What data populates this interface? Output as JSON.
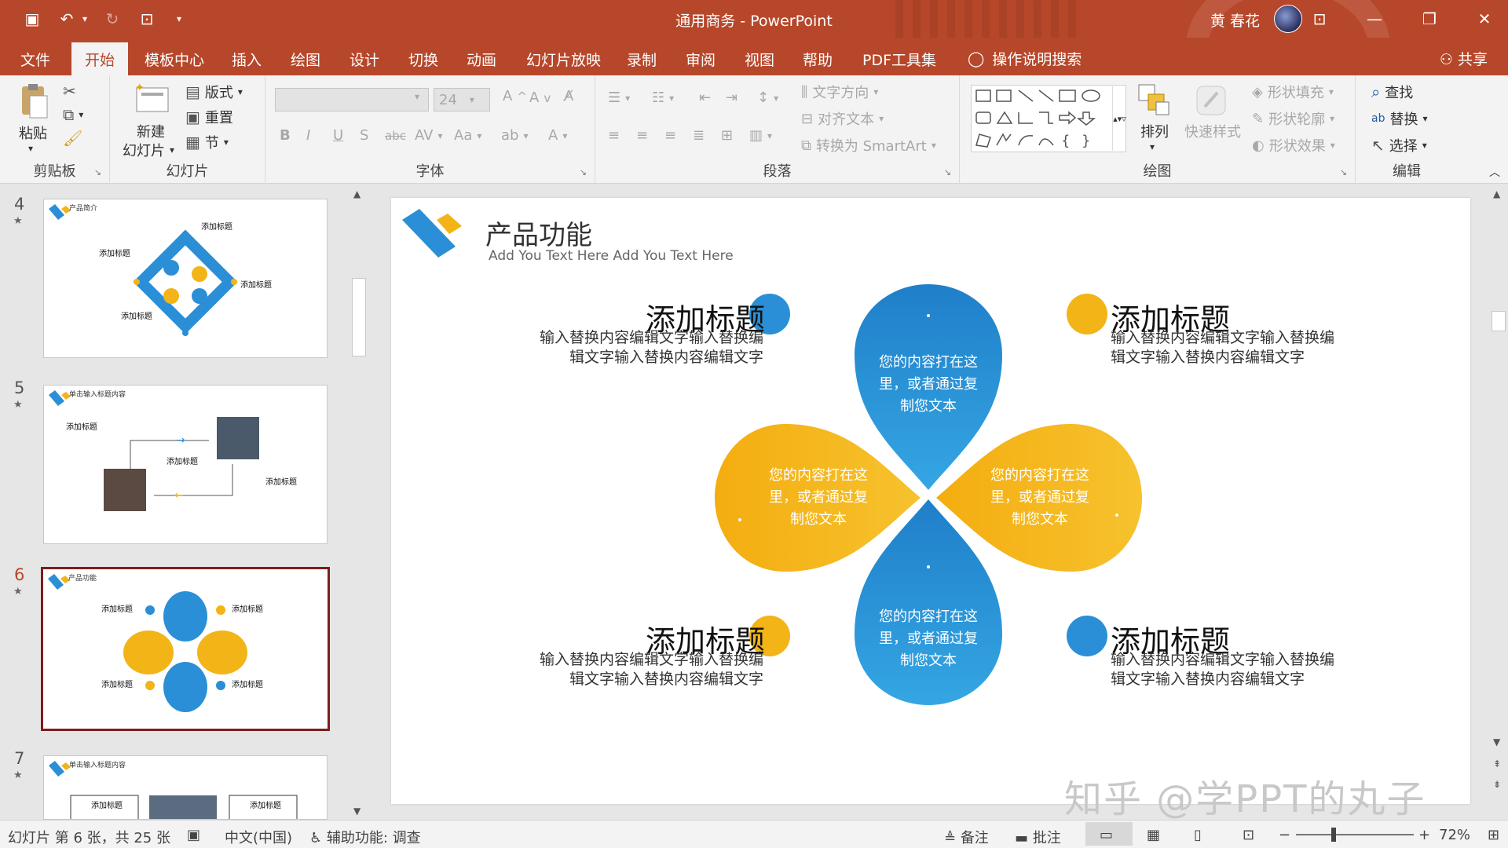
{
  "titlebar": {
    "document_title": "通用商务  -  PowerPoint",
    "user_name": "黄 春花",
    "window_buttons": [
      "ribbon-display-icon",
      "minimize-icon",
      "restore-icon",
      "close-icon"
    ]
  },
  "tabs": [
    {
      "label": "文件",
      "active": false
    },
    {
      "label": "开始",
      "active": true
    },
    {
      "label": "模板中心",
      "active": false
    },
    {
      "label": "插入",
      "active": false
    },
    {
      "label": "绘图",
      "active": false
    },
    {
      "label": "设计",
      "active": false
    },
    {
      "label": "切换",
      "active": false
    },
    {
      "label": "动画",
      "active": false
    },
    {
      "label": "幻灯片放映",
      "active": false
    },
    {
      "label": "录制",
      "active": false
    },
    {
      "label": "审阅",
      "active": false
    },
    {
      "label": "视图",
      "active": false
    },
    {
      "label": "帮助",
      "active": false
    },
    {
      "label": "PDF工具集",
      "active": false
    }
  ],
  "tell_me": "操作说明搜索",
  "share": "共享",
  "ribbon": {
    "clipboard": {
      "label": "剪贴板",
      "paste": "粘贴"
    },
    "slides": {
      "label": "幻灯片",
      "new_slide_1": "新建",
      "new_slide_2": "幻灯片",
      "layout": "版式",
      "reset": "重置",
      "section": "节"
    },
    "font": {
      "label": "字体",
      "font_name": "",
      "font_size": "24"
    },
    "paragraph": {
      "label": "段落",
      "text_direction": "文字方向",
      "align_text": "对齐文本",
      "smartart": "转换为 SmartArt"
    },
    "drawing": {
      "label": "绘图",
      "arrange": "排列",
      "quick_styles": "快速样式",
      "shape_fill": "形状填充",
      "shape_outline": "形状轮廓",
      "shape_effects": "形状效果"
    },
    "editing": {
      "label": "编辑",
      "find": "查找",
      "replace": "替换",
      "select": "选择"
    }
  },
  "thumbnails": [
    {
      "number": "4",
      "title": "产品简介",
      "heading": "添加标题"
    },
    {
      "number": "5",
      "title": "单击输入标题内容",
      "heading": "添加标题"
    },
    {
      "number": "6",
      "title": "产品功能",
      "heading": "添加标题",
      "selected": true
    },
    {
      "number": "7",
      "title": "单击输入标题内容",
      "heading": "添加标题"
    }
  ],
  "slide": {
    "title": "产品功能",
    "subtitle": "Add You Text Here Add You Text Here",
    "items": [
      {
        "heading": "添加标题",
        "text": "输入替换内容编辑文字输入替换编辑文字输入替换内容编辑文字"
      },
      {
        "heading": "添加标题",
        "text": "输入替换内容编辑文字输入替换编辑文字输入替换内容编辑文字"
      },
      {
        "heading": "添加标题",
        "text": "输入替换内容编辑文字输入替换编辑文字输入替换内容编辑文字"
      },
      {
        "heading": "添加标题",
        "text": "输入替换内容编辑文字输入替换编辑文字输入替换内容编辑文字"
      }
    ],
    "petal_text": "您的内容打在这里，或者通过复制您文本",
    "colors": {
      "blue": "#2a8fd6",
      "yellow": "#f2b417",
      "accent": "#b7472a"
    }
  },
  "watermark": "知乎 @学PPT的丸子",
  "statusbar": {
    "slide_info": "幻灯片 第 6 张，共 25 张",
    "language": "中文(中国)",
    "accessibility": "辅助功能: 调查",
    "notes": "备注",
    "comments": "批注",
    "zoom": "72%"
  }
}
